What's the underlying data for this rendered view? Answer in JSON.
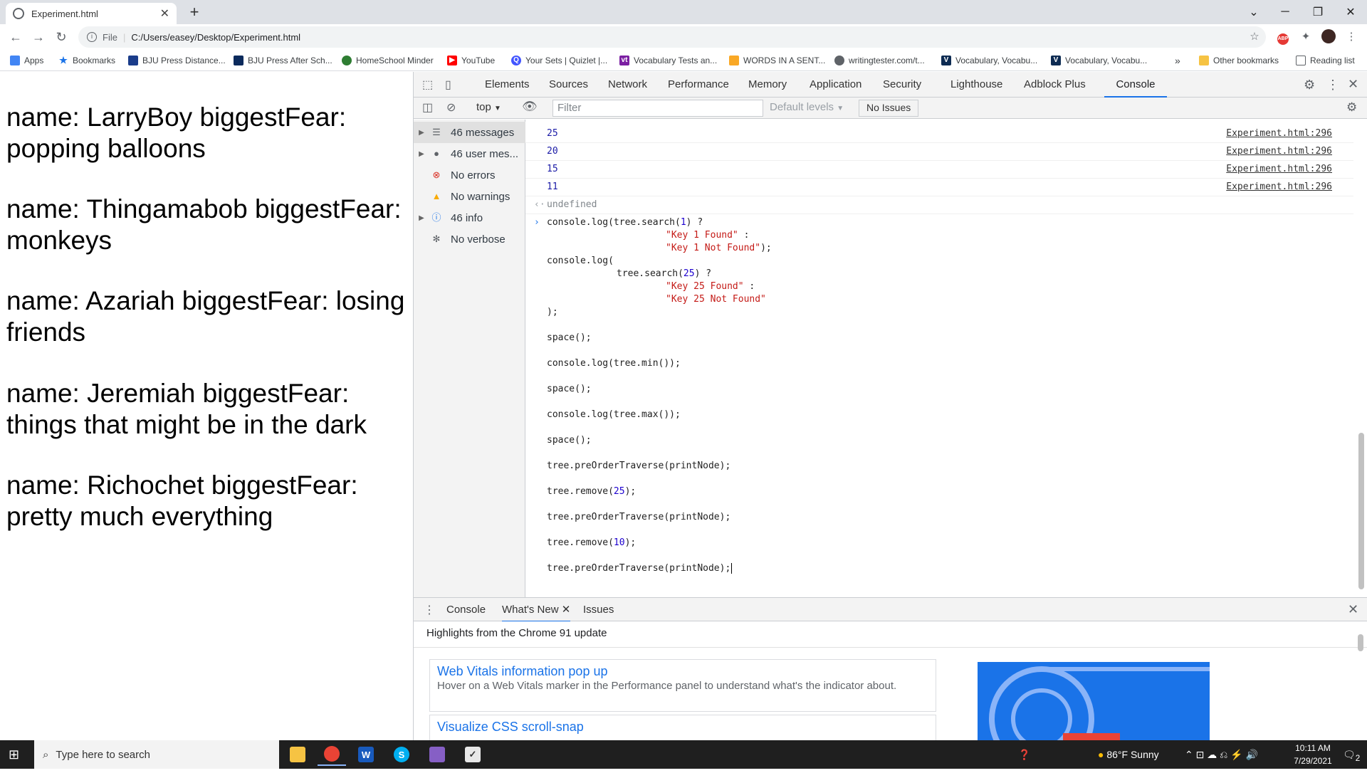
{
  "browser": {
    "tab_title": "Experiment.html",
    "new_tab": "+",
    "address_scheme": "File",
    "address_url": "C:/Users/easey/Desktop/Experiment.html"
  },
  "bookmarks": {
    "items": [
      {
        "label": "Apps",
        "color": "#4285f4"
      },
      {
        "label": "Bookmarks",
        "color": "#1a73e8"
      },
      {
        "label": "BJU Press Distance...",
        "color": "#1a3c8a"
      },
      {
        "label": "BJU Press After Sch...",
        "color": "#0b2a5c"
      },
      {
        "label": "HomeSchool Minder",
        "color": "#2e7d32"
      },
      {
        "label": "YouTube",
        "color": "#ff0000"
      },
      {
        "label": "Your Sets | Quizlet |...",
        "color": "#4255ff"
      },
      {
        "label": "Vocabulary Tests an...",
        "color": "#7b1fa2"
      },
      {
        "label": "WORDS IN A SENT...",
        "color": "#f9a825"
      },
      {
        "label": "writingtester.com/t...",
        "color": "#5f6368"
      },
      {
        "label": "Vocabulary, Vocabu...",
        "color": "#0d2b52"
      },
      {
        "label": "Vocabulary, Vocabu...",
        "color": "#0d2b52"
      }
    ],
    "more": "»",
    "other": "Other bookmarks",
    "reading": "Reading list"
  },
  "page": {
    "records": [
      "name: LarryBoy biggestFear: popping balloons",
      "name: Thingamabob biggestFear: monkeys",
      "name: Azariah biggestFear: losing friends",
      "name: Jeremiah biggestFear: things that might be in the dark",
      "name: Richochet biggestFear: pretty much everything"
    ]
  },
  "devtools": {
    "tabs": [
      "Elements",
      "Sources",
      "Network",
      "Performance",
      "Memory",
      "Application",
      "Security",
      "Lighthouse",
      "Adblock Plus",
      "Console"
    ],
    "context": "top",
    "filter_placeholder": "Filter",
    "levels": "Default levels",
    "issues": "No Issues",
    "sidebar": [
      {
        "label": "46 messages",
        "icon": "list-icon"
      },
      {
        "label": "46 user mes...",
        "icon": "user-icon"
      },
      {
        "label": "No errors",
        "icon": "error-icon"
      },
      {
        "label": "No warnings",
        "icon": "warning-icon"
      },
      {
        "label": "46 info",
        "icon": "info-icon"
      },
      {
        "label": "No verbose",
        "icon": "bug-icon"
      }
    ],
    "logs": [
      {
        "value": "25",
        "source": "Experiment.html:296"
      },
      {
        "value": "20",
        "source": "Experiment.html:296"
      },
      {
        "value": "15",
        "source": "Experiment.html:296"
      },
      {
        "value": "11",
        "source": "Experiment.html:296"
      }
    ],
    "undefined": "undefined",
    "code": {
      "l1a": "console.log(tree.search(",
      "l1n": "1",
      "l1b": ") ?",
      "l2": "\"Key 1 Found\"",
      "l2b": " :",
      "l3": "\"Key 1 Not Found\"",
      "l3b": ");",
      "l4": "console.log(",
      "l5a": "tree.search(",
      "l5n": "25",
      "l5b": ") ?",
      "l6": "\"Key 25 Found\"",
      "l6b": " :",
      "l7": "\"Key 25 Not Found\"",
      "l8": ");",
      "l9": "space();",
      "l10": "console.log(tree.min());",
      "l11": "space();",
      "l12": "console.log(tree.max());",
      "l13": "space();",
      "l14": "tree.preOrderTraverse(printNode);",
      "l15a": "tree.remove(",
      "l15n": "25",
      "l15b": ");",
      "l16": "tree.preOrderTraverse(printNode);",
      "l17a": "tree.remove(",
      "l17n": "10",
      "l17b": ");",
      "l18": "tree.preOrderTraverse(printNode);"
    },
    "drawer": {
      "tabs": [
        "Console",
        "What's New",
        "Issues"
      ],
      "highlights": "Highlights from the Chrome 91 update",
      "card1_title": "Web Vitals information pop up",
      "card1_desc": "Hover on a Web Vitals marker in the Performance panel to understand what's the indicator about.",
      "card2_title": "Visualize CSS scroll-snap"
    }
  },
  "taskbar": {
    "search_placeholder": "Type here to search",
    "weather": "86°F  Sunny",
    "time": "10:11 AM",
    "date": "7/29/2021",
    "notifications": "2"
  }
}
